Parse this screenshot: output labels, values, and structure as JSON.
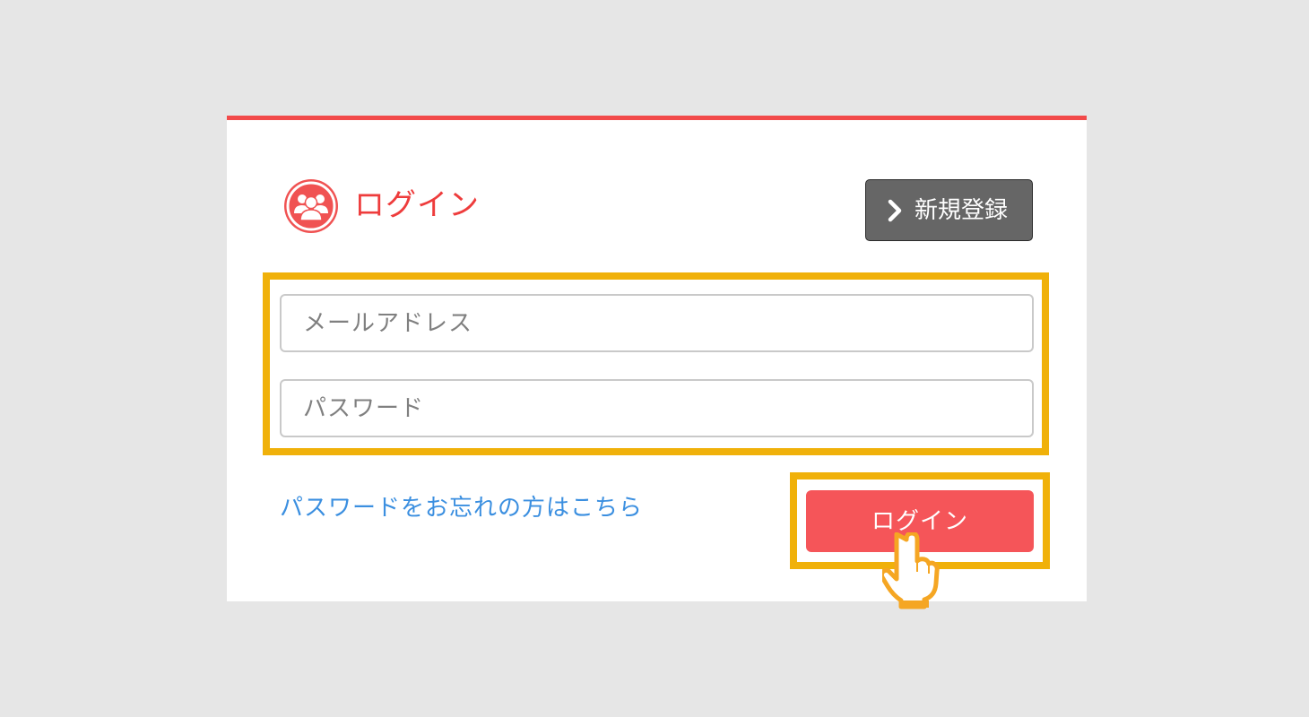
{
  "login_card": {
    "title": "ログイン",
    "register_button_label": "新規登録",
    "email_placeholder": "メールアドレス",
    "password_placeholder": "パスワード",
    "forgot_password_link": "パスワードをお忘れの方はこちら",
    "login_button_label": "ログイン"
  },
  "icons": {
    "title_icon": "users-group-icon",
    "register_icon": "chevron-right-icon",
    "pointer_icon": "pointing-hand-icon"
  },
  "colors": {
    "accent_red": "#f24a4a",
    "login_button": "#f55559",
    "register_button": "#666666",
    "highlight": "#f0b10a",
    "link": "#3b8fe0",
    "background": "#e6e6e6"
  }
}
